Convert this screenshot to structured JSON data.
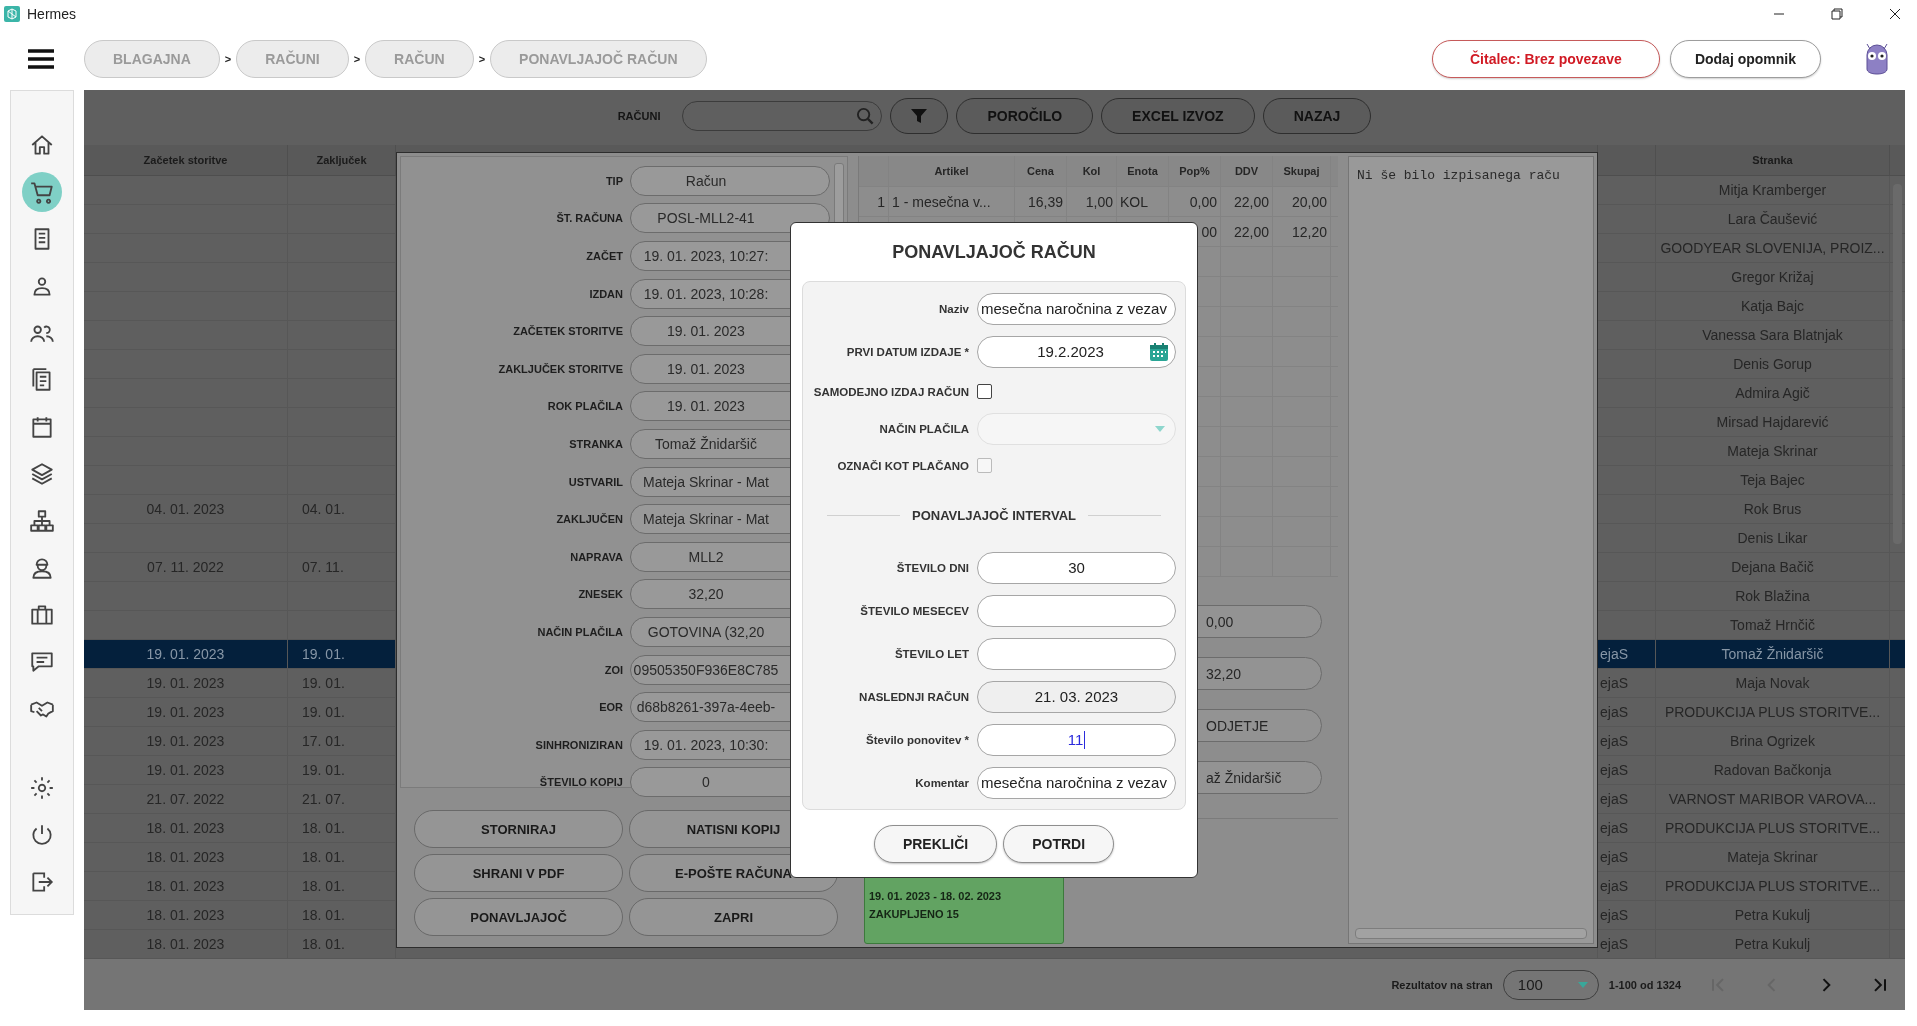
{
  "window": {
    "title": "Hermes"
  },
  "breadcrumbs": {
    "separator": ">",
    "items": [
      {
        "label": "BLAGAJNA"
      },
      {
        "label": "RAČUNI"
      },
      {
        "label": "RAČUN"
      },
      {
        "label": "PONAVLJAJOČ RAČUN"
      }
    ]
  },
  "header_actions": [
    {
      "label": "Čitalec: Brez povezave",
      "kind": "alert"
    },
    {
      "label": "Dodaj opomnik",
      "kind": "normal"
    }
  ],
  "sidebar": {
    "items": [
      {
        "selected": false
      },
      {
        "selected": true
      },
      {
        "selected": false
      },
      {
        "selected": false
      },
      {
        "selected": false
      },
      {
        "selected": false
      },
      {
        "selected": false
      },
      {
        "selected": false
      },
      {
        "selected": false
      },
      {
        "selected": false
      },
      {
        "selected": false
      },
      {
        "selected": false
      },
      {
        "selected": false
      }
    ],
    "bottom_items": [
      {
        "selected": false
      },
      {
        "selected": false
      },
      {
        "selected": false
      }
    ]
  },
  "toolbar": {
    "label": "RAČUNI",
    "buttons": [
      "POROČILO",
      "EXCEL IZVOZ",
      "NAZAJ"
    ]
  },
  "table": {
    "columns": [
      "Začetek storitve",
      "Zaključek",
      "Stranka"
    ],
    "rows": [
      {
        "customer": "Mitja Kramberger",
        "selected": false
      },
      {
        "customer": "Lara Čaušević",
        "selected": false
      },
      {
        "customer": "GOODYEAR SLOVENIJA, PROIZ...",
        "selected": false
      },
      {
        "customer": "Gregor Križaj",
        "selected": false
      },
      {
        "customer": "Katja Bajc",
        "selected": false
      },
      {
        "customer": "Vanessa Sara Blatnjak",
        "selected": false
      },
      {
        "customer": "Denis Gorup",
        "selected": false
      },
      {
        "customer": "Admira Agič",
        "selected": false
      },
      {
        "customer": "Mirsad Hajdarević",
        "selected": false
      },
      {
        "customer": "Mateja Skrinar",
        "selected": false
      },
      {
        "customer": "Teja Bajec",
        "selected": false
      },
      {
        "start": "04. 01. 2023",
        "end": "04. 01.",
        "customer": "Rok Brus",
        "selected": false
      },
      {
        "customer": "Denis Likar",
        "selected": false
      },
      {
        "start": "07. 11. 2022",
        "end": "07. 11.",
        "customer": "Dejana Bačič",
        "selected": false
      },
      {
        "customer": "Rok Blažina",
        "selected": false
      },
      {
        "customer": "Tomaž Hrnčič",
        "selected": false
      },
      {
        "start": "19. 01. 2023",
        "end": "19. 01.",
        "column_3": "ejaS",
        "customer": "Tomaž Žnidaršič",
        "selected": true
      },
      {
        "start": "19. 01. 2023",
        "end": "19. 01.",
        "column_3": "ejaS",
        "customer": "Maja Novak",
        "selected": false
      },
      {
        "start": "19. 01. 2023",
        "end": "19. 01.",
        "column_3": "ejaS",
        "customer": "PRODUKCIJA PLUS STORITVE...",
        "selected": false
      },
      {
        "start": "19. 01. 2023",
        "end": "17. 01.",
        "column_3": "ejaS",
        "customer": "Brina Ogrizek",
        "selected": false
      },
      {
        "start": "19. 01. 2023",
        "end": "19. 01.",
        "column_3": "ejaS",
        "customer": "Radovan Bačkonja",
        "selected": false
      },
      {
        "start": "21. 07. 2022",
        "end": "21. 07.",
        "column_3": "ejaS",
        "customer": "VARNOST MARIBOR VAROVA...",
        "selected": false
      },
      {
        "start": "18. 01. 2023",
        "end": "18. 01.",
        "column_3": "ejaS",
        "customer": "PRODUKCIJA PLUS STORITVE...",
        "selected": false
      },
      {
        "start": "18. 01. 2023",
        "end": "18. 01.",
        "column_3": "ejaS",
        "customer": "Mateja Skrinar",
        "selected": false
      },
      {
        "start": "18. 01. 2023",
        "end": "18. 01.",
        "column_3": "ejaS",
        "customer": "PRODUKCIJA PLUS STORITVE...",
        "selected": false
      },
      {
        "start": "18. 01. 2023",
        "end": "18. 01.",
        "column_3": "ejaS",
        "customer": "Petra Kukulj",
        "selected": false
      },
      {
        "start": "18. 01. 2023",
        "end": "18. 01.",
        "column_3": "ejaS",
        "customer": "Petra Kukulj",
        "selected": false
      }
    ]
  },
  "detail": {
    "fields": [
      {
        "label": "TIP",
        "value": "Račun"
      },
      {
        "label": "ŠT. RAČUNA",
        "value": "POSL-MLL2-41"
      },
      {
        "label": "ZAČET",
        "value": "19. 01. 2023, 10:27:"
      },
      {
        "label": "IZDAN",
        "value": "19. 01. 2023, 10:28:"
      },
      {
        "label": "ZAČETEK STORITVE",
        "value": "19. 01. 2023"
      },
      {
        "label": "ZAKLJUČEK STORITVE",
        "value": "19. 01. 2023"
      },
      {
        "label": "ROK PLAČILA",
        "value": "19. 01. 2023"
      },
      {
        "label": "STRANKA",
        "value": "Tomaž Žnidaršič"
      },
      {
        "label": "USTVARIL",
        "value": "Mateja Skrinar - Mat"
      },
      {
        "label": "ZAKLJUČEN",
        "value": "Mateja Skrinar - Mat"
      },
      {
        "label": "NAPRAVA",
        "value": "MLL2"
      },
      {
        "label": "ZNESEK",
        "value": "32,20"
      },
      {
        "label": "NAČIN PLAČILA",
        "value": "GOTOVINA (32,20"
      },
      {
        "label": "ZOI",
        "value": "09505350F936E8C785"
      },
      {
        "label": "EOR",
        "value": "d68b8261-397a-4eeb-"
      },
      {
        "label": "SINHRONIZIRAN",
        "value": "19. 01. 2023, 10:30:"
      },
      {
        "label": "ŠTEVILO KOPIJ",
        "value": "0"
      }
    ],
    "buttons": [
      "STORNIRAJ",
      "NATISNI KOPIJ",
      "SHRANI V PDF",
      "E-POŠTE RAČUNA",
      "PONAVLJAJOČ",
      "ZAPRI"
    ],
    "items": {
      "columns": [
        "Artikel",
        "Cena",
        "Kol",
        "Enota",
        "Pop%",
        "DDV",
        "Skupaj"
      ],
      "rows": [
        {
          "index": "1",
          "article": "1 - mesečna v...",
          "price": "16,39",
          "qty": "1,00",
          "unit": "KOL",
          "discount": "0,00",
          "vat": "22,00",
          "total": "20,00"
        },
        {
          "discount": "00",
          "vat": "22,00",
          "total": "12,20"
        }
      ]
    },
    "summary_fields": [
      "0,00",
      "32,20",
      "ODJETJE",
      "až Žnidaršič"
    ],
    "period_card": {
      "lines": [
        "19. 01. 2023 - 18. 02. 2023",
        "ZAKUPLJENO 15"
      ]
    },
    "preview_text": "Ni še bilo izpisanega raču"
  },
  "dialog": {
    "title": "PONAVLJAJOČ RAČUN",
    "fields": [
      {
        "kind": "text",
        "label": "Naziv",
        "value": "mesečna naročnina z vezav",
        "focused": false
      },
      {
        "kind": "date",
        "label": "PRVI DATUM IZDAJE *",
        "value": "19.2.2023"
      },
      {
        "kind": "checkbox",
        "label": "SAMODEJNO IZDAJ RAČUN",
        "checked": false,
        "disabled": false
      },
      {
        "kind": "select",
        "label": "NAČIN PLAČILA",
        "disabled": true
      },
      {
        "kind": "checkbox",
        "label": "OZNAČI KOT PLAČANO",
        "checked": false,
        "disabled": true
      },
      {
        "kind": "section",
        "label": "PONAVLJAJOČ INTERVAL"
      },
      {
        "kind": "number",
        "label": "ŠTEVILO DNI",
        "value": "30",
        "focused": false
      },
      {
        "kind": "number",
        "label": "ŠTEVILO MESECEV",
        "focused": false
      },
      {
        "kind": "number",
        "label": "ŠTEVILO LET",
        "focused": false
      },
      {
        "kind": "readonly",
        "label": "NASLEDNJI RAČUN",
        "value": "21. 03. 2023"
      },
      {
        "kind": "number",
        "label": "Število ponovitev *",
        "value": "11",
        "focused": true
      },
      {
        "kind": "text",
        "label": "Komentar",
        "value": "mesečna naročnina z vezav",
        "focused": false
      }
    ],
    "buttons": [
      "PREKLIČI",
      "POTRDI"
    ]
  },
  "pagination": {
    "label": "Rezultatov na stran",
    "page_size": "100",
    "range": "1-100 od 1324",
    "buttons": [
      {
        "disabled": true
      },
      {
        "disabled": true
      },
      {
        "disabled": false
      },
      {
        "disabled": false
      }
    ]
  }
}
